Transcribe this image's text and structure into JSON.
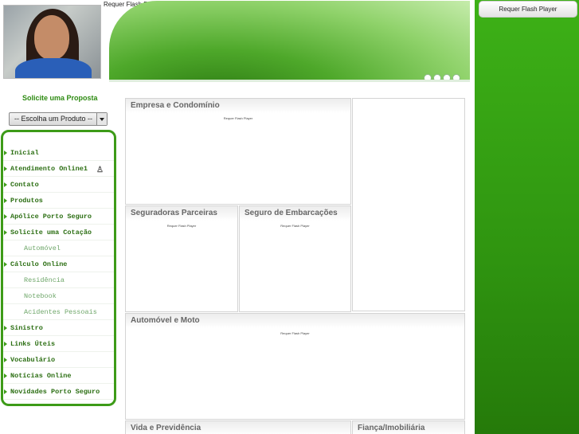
{
  "header": {
    "flash_message": "Requer Flash Player"
  },
  "sidebar": {
    "proposal_title": "Solicite uma Proposta",
    "product_select_value": "-- Escolha um Produto --",
    "menu": [
      {
        "label": "Inicial",
        "sub": false
      },
      {
        "label": "Atendimento Online1",
        "sub": false
      },
      {
        "label": "Contato",
        "sub": false
      },
      {
        "label": "Produtos",
        "sub": false
      },
      {
        "label": "Apólice Porto Seguro",
        "sub": false
      },
      {
        "label": "Solicite uma Cotação",
        "sub": false
      },
      {
        "label": "Automóvel",
        "sub": true
      },
      {
        "label": "Cálculo Online",
        "sub": false
      },
      {
        "label": "Residência",
        "sub": true
      },
      {
        "label": "Notebook",
        "sub": true
      },
      {
        "label": "Acidentes Pessoais",
        "sub": true
      },
      {
        "label": "Sinistro",
        "sub": false
      },
      {
        "label": "Links Úteis",
        "sub": false
      },
      {
        "label": "Vocabulário",
        "sub": false
      },
      {
        "label": "Notícias Online",
        "sub": false
      },
      {
        "label": "Novidades Porto Seguro",
        "sub": false
      }
    ]
  },
  "main": {
    "box_empresa_title": "Empresa e Condomínio",
    "box_seguradoras_title": "Seguradoras Parceiras",
    "box_embarcacoes_title": "Seguro de Embarcações",
    "box_auto_title": "Automóvel e Moto",
    "box_vida_title": "Vida e Previdência",
    "box_fianca_title": "Fiança/Imobiliária",
    "flash_small": "Requer Flash Player"
  },
  "right": {
    "flash_button": "Requer Flash Player"
  },
  "colors": {
    "brand_green": "#3d9b18",
    "menu_text": "#2b6e12",
    "sub_text": "#6fa76a"
  }
}
